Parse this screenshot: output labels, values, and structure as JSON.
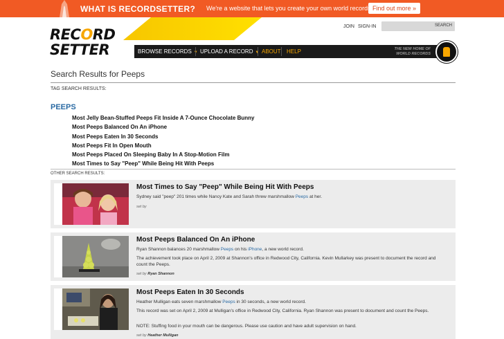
{
  "banner": {
    "title": "WHAT IS RECORDSETTER?",
    "tagline": "We're a website that lets you create your own world records.",
    "cta": "Find out more »"
  },
  "header": {
    "logo_line1_a": "REC",
    "logo_line1_flame": "O",
    "logo_line1_b": "RD",
    "logo_line2": "SETTER",
    "join": "JOIN",
    "signin": "SIGN-IN",
    "search_button": "SEARCH",
    "nav": [
      {
        "label": "BROWSE RECORDS"
      },
      {
        "label": "UPLOAD A RECORD"
      },
      {
        "label": "ABOUT"
      },
      {
        "label": "HELP"
      }
    ],
    "tagline_line1": "THE NEW HOME OF",
    "tagline_line2": "WORLD RECORDS"
  },
  "main": {
    "page_title": "Search Results for Peeps",
    "tag_search_heading": "TAG SEARCH RESULTS:",
    "tag_name": "PEEPS",
    "tag_results": [
      "Most Jelly Bean-Stuffed Peeps Fit Inside A 7-Ounce Chocolate Bunny",
      "Most Peeps Balanced On An iPhone",
      "Most Peeps Eaten In 30 Seconds",
      "Most Peeps Fit In Open Mouth",
      "Most Peeps Placed On Sleeping Baby In A Stop-Motion Film",
      "Most Times to Say \"Peep\" While Being Hit With Peeps"
    ],
    "other_search_heading": "OTHER SEARCH RESULTS:",
    "results": [
      {
        "title": "Most Times to Say \"Peep\" While Being Hit With Peeps",
        "desc1_a": "Sydney said \"peep\" 201 times while Nancy Kate and Sarah threw marshmallow ",
        "desc1_link": "Peeps",
        "desc1_b": " at her.",
        "setby_prefix": "set by",
        "setby_name": ""
      },
      {
        "title": "Most Peeps Balanced On An iPhone",
        "desc1_a": "Ryan Shannon balances 20 marshmallow ",
        "desc1_link": "Peeps",
        "desc1_mid": " on his ",
        "desc1_link2": "iPhone",
        "desc1_b": ", a new world record.",
        "desc2": "The achievement took place on April 2, 2009 at Shannon's office in Redwood City, California. Kevin Mullarkey was present to document the record and count the Peeps.",
        "setby_prefix": "set by",
        "setby_name": "Ryan Shannon"
      },
      {
        "title": "Most Peeps Eaten In 30 Seconds",
        "desc1_a": "Heather Mulligan eats seven marshmallow ",
        "desc1_link": "Peeps",
        "desc1_b": " in 30 seconds, a new world record.",
        "desc2": "This record was set on April 2, 2009 at Mulligan's office in Redwood City, California. Ryan Shannon was present to document and count the Peeps.",
        "desc3": "NOTE: Stuffing food in your mouth can be dangerous. Please use caution and have adult supervision on hand.",
        "setby_prefix": "set by",
        "setby_name": "Heather Mulligan"
      }
    ]
  }
}
